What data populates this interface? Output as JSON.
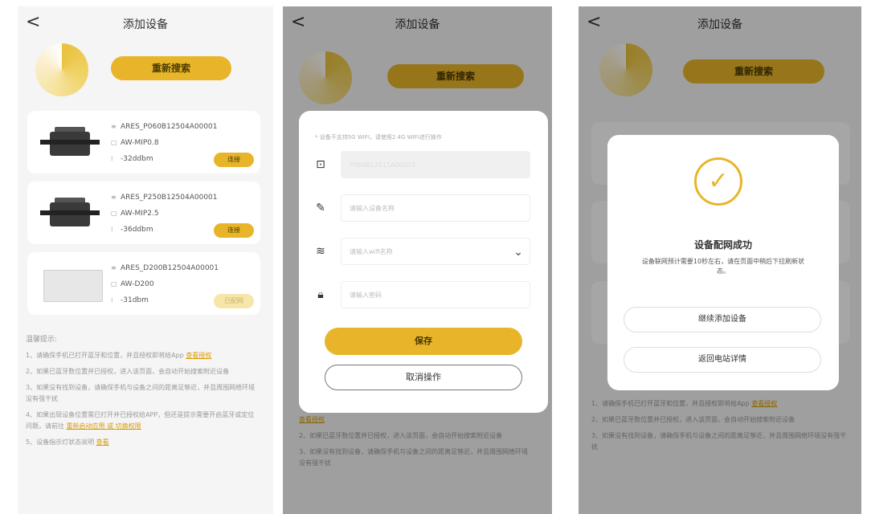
{
  "header": {
    "title": "添加设备",
    "back": "<"
  },
  "research_label": "重新搜索",
  "devices": [
    {
      "sn": "ARES_P060B12504A00001",
      "model": "AW-MIP0.8",
      "signal": "-32ddbm",
      "action": "连接"
    },
    {
      "sn": "ARES_P250B12504A00001",
      "model": "AW-MIP2.5",
      "signal": "-36ddbm",
      "action": "连接"
    },
    {
      "sn": "ARES_D200B12504A00001",
      "model": "AW-D200",
      "signal": "-31dbm",
      "action": "已配网"
    }
  ],
  "tips": {
    "heading": "温馨提示:",
    "items": [
      {
        "text": "1、请确保手机已打开蓝牙和位置，并且授权即将给App",
        "link": "查看授权"
      },
      {
        "text": "2、如果已蓝牙数位置并已授权，进入该页面，会自动开始搜索附近设备",
        "link": ""
      },
      {
        "text": "3、如果没有找到设备，请确保手机与设备之间的距离足够近，并且周围网络环境没有强干扰",
        "link": ""
      },
      {
        "text": "4、如果出现设备位置需已打开并已授权给APP，但还是提示需要开启蓝牙或定位问题，请前往",
        "link": "重新启动应用 或 切换权限"
      },
      {
        "text": "5、设备指示灯状态说明",
        "link": "查看"
      }
    ]
  },
  "form": {
    "notice": "* 设备不支持5G WIFI，请使用2.4G WIFI进行操作",
    "device_id": "P060B12511A00003",
    "name_placeholder": "请输入设备名称",
    "wifi_placeholder": "请输入wifi名称",
    "password_placeholder": "请输入密码",
    "save_label": "保存",
    "cancel_label": "取消操作"
  },
  "success": {
    "title": "设备配网成功",
    "desc": "设备联网预计需要10秒左右，请在页面中稍后下拉刷新状态。",
    "continue_label": "继续添加设备",
    "back_label": "返回电站详情"
  },
  "icons": {
    "back": "chevron-left-icon",
    "scan": "scan-icon",
    "edit": "edit-icon",
    "wifi": "wifi-icon",
    "lock": "lock-icon",
    "check": "check-icon"
  },
  "colors": {
    "accent": "#e8b52a",
    "background": "#f5f5f6",
    "overlay": "rgba(0,0,0,0.35)"
  }
}
